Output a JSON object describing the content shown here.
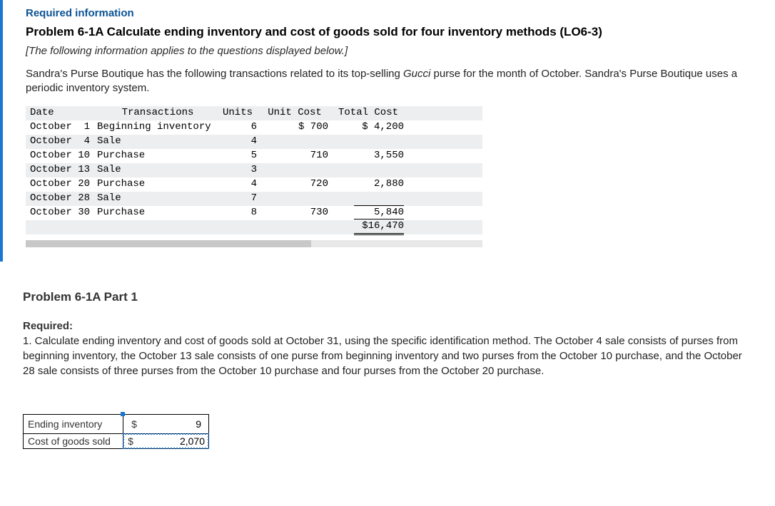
{
  "header": {
    "required": "Required information",
    "problem_title": "Problem 6-1A Calculate ending inventory and cost of goods sold for four inventory methods (LO6-3)",
    "italic_note": "[The following information applies to the questions displayed below.]",
    "body_pre": "Sandra's Purse Boutique has the following transactions related to its top-selling ",
    "body_em": "Gucci",
    "body_post": " purse for the month of October. Sandra's Purse Boutique uses a periodic inventory system."
  },
  "trans": {
    "headers": {
      "date": "Date",
      "trans": "Transactions",
      "units": "Units",
      "unitcost": "Unit Cost",
      "totalcost": "Total Cost"
    },
    "rows": [
      {
        "date": "October  1",
        "trans": "Beginning inventory",
        "units": "6",
        "unitcost": "$ 700",
        "totalcost": "$ 4,200"
      },
      {
        "date": "October  4",
        "trans": "Sale",
        "units": "4",
        "unitcost": "",
        "totalcost": ""
      },
      {
        "date": "October 10",
        "trans": "Purchase",
        "units": "5",
        "unitcost": "710",
        "totalcost": "3,550"
      },
      {
        "date": "October 13",
        "trans": "Sale",
        "units": "3",
        "unitcost": "",
        "totalcost": ""
      },
      {
        "date": "October 20",
        "trans": "Purchase",
        "units": "4",
        "unitcost": "720",
        "totalcost": "2,880"
      },
      {
        "date": "October 28",
        "trans": "Sale",
        "units": "7",
        "unitcost": "",
        "totalcost": ""
      },
      {
        "date": "October 30",
        "trans": "Purchase",
        "units": "8",
        "unitcost": "730",
        "totalcost": "5,840"
      }
    ],
    "grand_total": "$16,470"
  },
  "part": {
    "title": "Problem 6-1A Part 1",
    "required_label": "Required:",
    "required_body": "1. Calculate ending inventory and cost of goods sold at October 31, using the specific identification method. The October 4 sale consists of purses from beginning inventory, the October 13 sale consists of one purse from beginning inventory and two purses from the October 10 purchase, and the October 28 sale consists of three purses from the October 10 purchase and four purses from the October 20 purchase."
  },
  "answers": {
    "rows": [
      {
        "label": "Ending inventory",
        "value": "9",
        "selected": false,
        "handle": true
      },
      {
        "label": "Cost of goods sold",
        "value": "2,070",
        "selected": true,
        "handle": false
      }
    ],
    "dollar": "$"
  }
}
